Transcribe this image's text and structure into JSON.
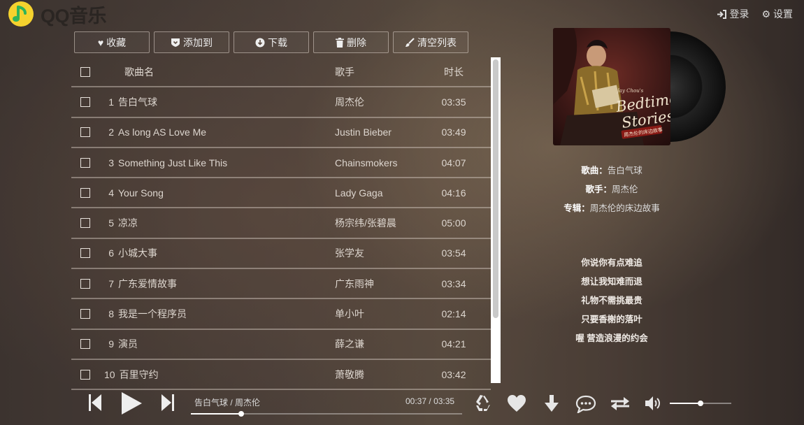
{
  "app": {
    "logo_text": "QQ音乐"
  },
  "top_links": {
    "login": "登录",
    "settings": "设置"
  },
  "toolbar": {
    "favorite": "收藏",
    "add_to": "添加到",
    "download": "下载",
    "delete": "删除",
    "clear_list": "清空列表"
  },
  "list": {
    "headers": {
      "name": "歌曲名",
      "artist": "歌手",
      "duration": "时长"
    },
    "songs": [
      {
        "num": "1",
        "name": "告白气球",
        "artist": "周杰伦",
        "duration": "03:35"
      },
      {
        "num": "2",
        "name": "As long AS Love Me",
        "artist": "Justin Bieber",
        "duration": "03:49"
      },
      {
        "num": "3",
        "name": "Something Just Like This",
        "artist": "Chainsmokers",
        "duration": "04:07"
      },
      {
        "num": "4",
        "name": "Your Song",
        "artist": "Lady Gaga",
        "duration": "04:16"
      },
      {
        "num": "5",
        "name": "凉凉",
        "artist": "杨宗纬/张碧晨",
        "duration": "05:00"
      },
      {
        "num": "6",
        "name": "小城大事",
        "artist": "张学友",
        "duration": "03:54"
      },
      {
        "num": "7",
        "name": "广东爱情故事",
        "artist": "广东雨神",
        "duration": "03:34"
      },
      {
        "num": "8",
        "name": "我是一个程序员",
        "artist": "单小叶",
        "duration": "02:14"
      },
      {
        "num": "9",
        "name": "演员",
        "artist": "薛之谦",
        "duration": "04:21"
      },
      {
        "num": "10",
        "name": "百里守约",
        "artist": "萧敬腾",
        "duration": "03:42"
      }
    ]
  },
  "now_playing": {
    "song_label": "歌曲：",
    "song": "告白气球",
    "artist_label": "歌手：",
    "artist": "周杰伦",
    "album_label": "专辑：",
    "album": "周杰伦的床边故事",
    "cover_text_1": "Jay Chou's",
    "cover_text_2": "Bedtime",
    "cover_text_3": "Stories",
    "cover_text_4": "周杰伦的床边故事"
  },
  "lyrics": [
    "你说你有点难追",
    "想让我知难而退",
    "礼物不需挑最贵",
    "只要香榭的落叶",
    "喔 营造浪漫的约会"
  ],
  "player": {
    "track": "告白气球",
    "separator": "/",
    "track_artist": "周杰伦",
    "current_time": "00:37",
    "total_time": "03:35",
    "progress_fraction": 0.185,
    "volume_fraction": 0.5
  }
}
